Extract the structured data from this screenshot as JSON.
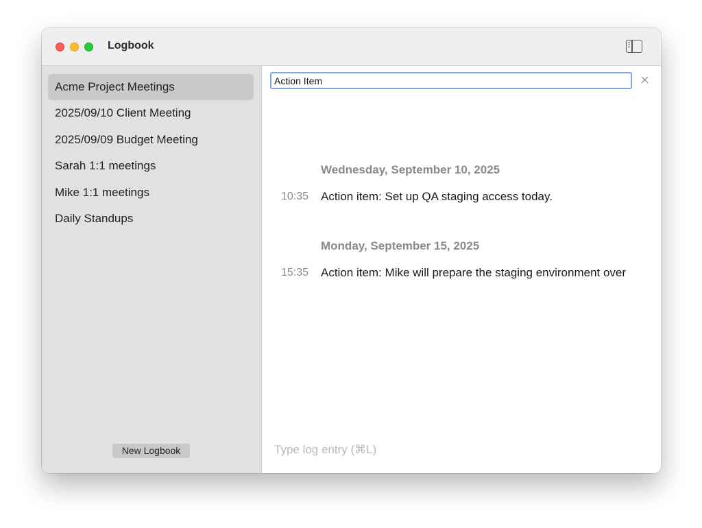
{
  "window": {
    "title": "Logbook"
  },
  "sidebar": {
    "items": [
      {
        "label": "Acme Project Meetings",
        "selected": true
      },
      {
        "label": "2025/09/10 Client Meeting"
      },
      {
        "label": "2025/09/09 Budget Meeting"
      },
      {
        "label": "Sarah 1:1 meetings"
      },
      {
        "label": "Mike 1:1 meetings"
      },
      {
        "label": "Daily Standups"
      }
    ],
    "new_button_label": "New Logbook"
  },
  "search": {
    "value": "Action Item"
  },
  "log": {
    "groups": [
      {
        "date": "Wednesday, September 10, 2025",
        "entries": [
          {
            "time": "10:35",
            "text": "Action item: Set up QA staging access today."
          }
        ]
      },
      {
        "date": "Monday, September 15, 2025",
        "entries": [
          {
            "time": "15:35",
            "text": "Action item: Mike will prepare the staging environment over"
          }
        ]
      }
    ]
  },
  "entry_input": {
    "placeholder": "Type log entry (⌘L)"
  },
  "colors": {
    "sidebar_bg": "#e1e1e1",
    "selection": "#c9c9c9",
    "focus_ring": "#7fa6e8",
    "muted_text": "#8a8a8a"
  }
}
